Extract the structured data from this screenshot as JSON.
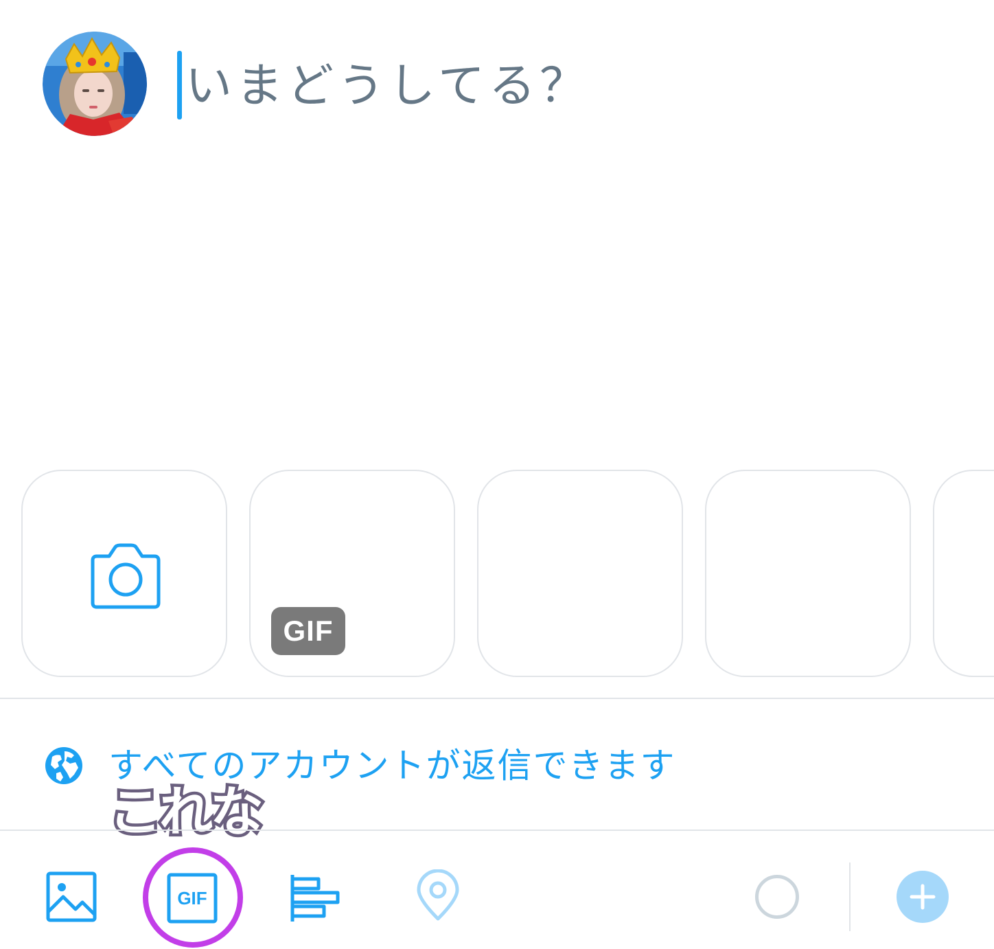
{
  "compose": {
    "placeholder": "いまどうしてる？",
    "avatar_icon": "user-avatar"
  },
  "media_strip": {
    "tiles": [
      {
        "kind": "camera",
        "icon": "camera-icon"
      },
      {
        "kind": "gif",
        "badge": "GIF"
      },
      {
        "kind": "empty"
      },
      {
        "kind": "empty"
      },
      {
        "kind": "empty"
      }
    ]
  },
  "reply_setting": {
    "icon": "globe-icon",
    "label": "すべてのアカウントが返信できます"
  },
  "annotation": {
    "text": "これな",
    "color": "#6a5f7e"
  },
  "toolbar": {
    "items": [
      {
        "icon": "image-icon"
      },
      {
        "icon": "gif-icon",
        "label": "GIF"
      },
      {
        "icon": "poll-icon"
      },
      {
        "icon": "location-icon"
      }
    ],
    "highlight_color": "#c23ee8",
    "add_icon": "plus-icon"
  },
  "colors": {
    "accent": "#1da1f2",
    "accent_disabled": "#a5d8fa",
    "placeholder": "#657786",
    "border": "#e1e4e8"
  }
}
